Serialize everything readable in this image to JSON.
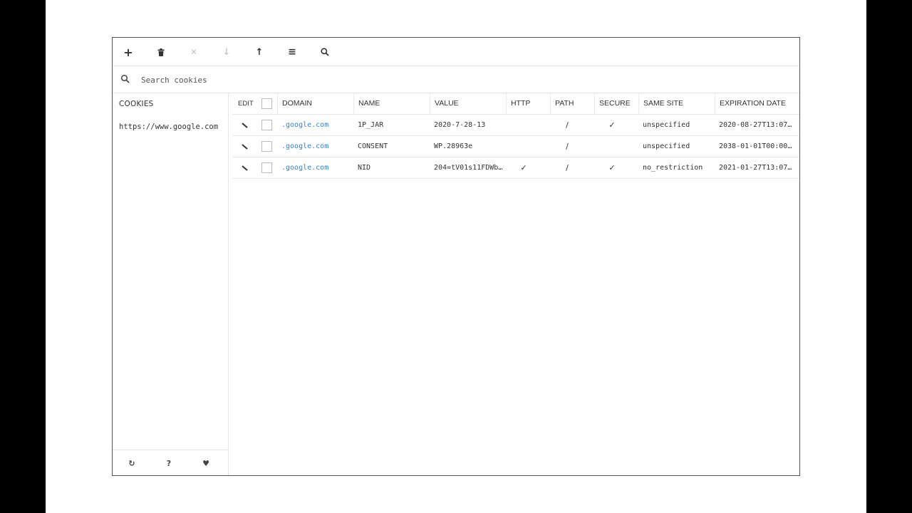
{
  "toolbar": {
    "buttons": [
      {
        "name": "add-cookie-button",
        "icon": "plus-icon",
        "glyph": "+",
        "disabled": false
      },
      {
        "name": "delete-all-button",
        "icon": "trash-icon",
        "glyph": "",
        "disabled": false
      },
      {
        "name": "delete-selected-button",
        "icon": "close-icon",
        "glyph": "✕",
        "disabled": true
      },
      {
        "name": "import-button",
        "icon": "arrow-down-icon",
        "glyph": "↓",
        "disabled": true
      },
      {
        "name": "export-button",
        "icon": "arrow-up-icon",
        "glyph": "↑",
        "disabled": false
      },
      {
        "name": "list-view-button",
        "icon": "list-icon",
        "glyph": "≡",
        "disabled": false
      },
      {
        "name": "search-toggle-button",
        "icon": "search-icon",
        "glyph": "",
        "disabled": false
      }
    ]
  },
  "search": {
    "placeholder": "Search cookies",
    "value": ""
  },
  "sidebar": {
    "header": "COOKIES",
    "items": [
      {
        "label": "https://www.google.com"
      }
    ],
    "footer": [
      {
        "name": "refresh-button",
        "icon": "refresh-icon",
        "glyph": "↻"
      },
      {
        "name": "help-button",
        "icon": "question-icon",
        "glyph": "?"
      },
      {
        "name": "favorite-button",
        "icon": "heart-icon",
        "glyph": "♥"
      }
    ]
  },
  "table": {
    "columns": {
      "edit": "EDIT",
      "domain": "DOMAIN",
      "name": "NAME",
      "value": "VALUE",
      "http": "HTTP",
      "path": "PATH",
      "secure": "SECURE",
      "same_site": "SAME SITE",
      "expiration": "EXPIRATION DATE"
    },
    "rows": [
      {
        "domain": ".google.com",
        "name": "1P_JAR",
        "value": "2020-7-28-13",
        "http": "",
        "path": "/",
        "secure": "✓",
        "same_site": "unspecified",
        "expiration": "2020-08-27T13:07…"
      },
      {
        "domain": ".google.com",
        "name": "CONSENT",
        "value": "WP.28963e",
        "http": "",
        "path": "/",
        "secure": "",
        "same_site": "unspecified",
        "expiration": "2038-01-01T00:00…"
      },
      {
        "domain": ".google.com",
        "name": "NID",
        "value": "204=tV01s11FDWbK…",
        "http": "✓",
        "path": "/",
        "secure": "✓",
        "same_site": "no_restriction",
        "expiration": "2021-01-27T13:07…"
      }
    ]
  },
  "colors": {
    "link": "#3a80c8",
    "border": "#555555",
    "divider": "#e5e5e5"
  }
}
